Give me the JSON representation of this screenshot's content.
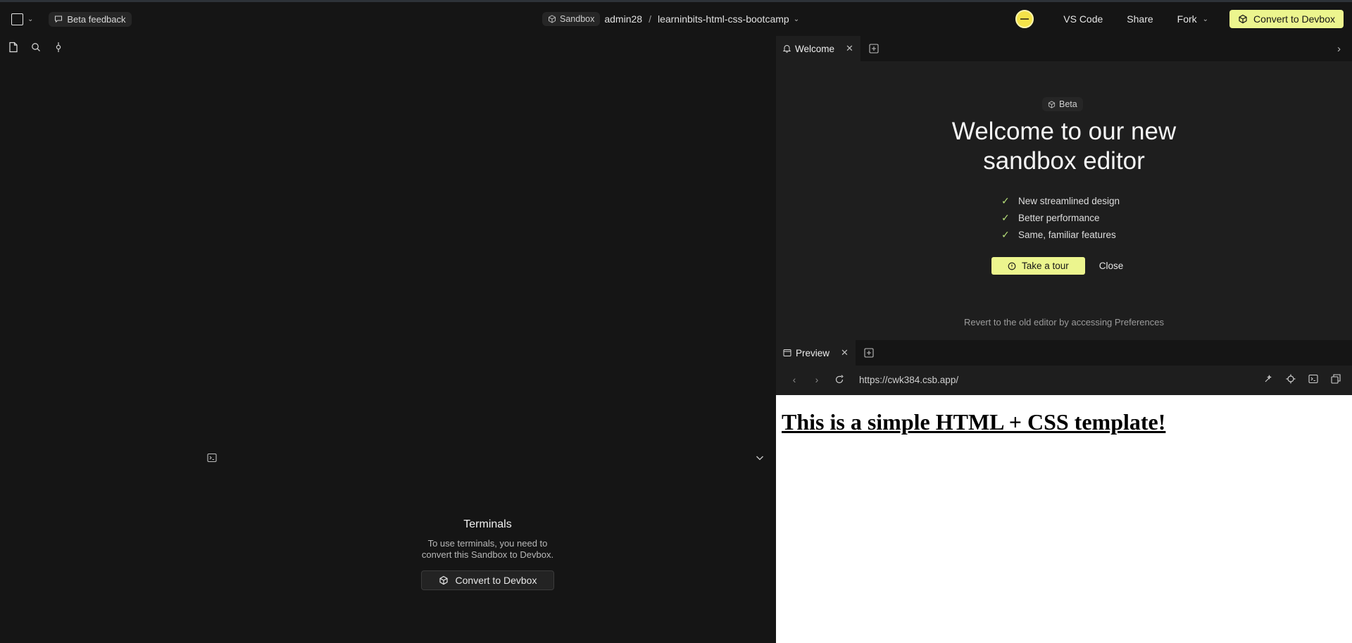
{
  "header": {
    "beta_feedback": "Beta feedback",
    "sandbox_label": "Sandbox",
    "owner": "admin28",
    "separator": "/",
    "project": "learninbits-html-css-bootcamp",
    "vscode": "VS Code",
    "share": "Share",
    "fork": "Fork",
    "convert": "Convert to Devbox",
    "accent_color": "#ecf58e"
  },
  "left_panel": {
    "icons": [
      "file-icon",
      "search-icon",
      "git-icon"
    ]
  },
  "terminal": {
    "title": "Terminals",
    "description": "To use terminals, you need to convert this Sandbox to Devbox.",
    "button": "Convert to Devbox"
  },
  "welcome_tab": {
    "label": "Welcome",
    "beta": "Beta",
    "title": "Welcome to our new sandbox editor",
    "features": [
      "New streamlined design",
      "Better performance",
      "Same, familiar features"
    ],
    "tour_button": "Take a tour",
    "close_button": "Close",
    "revert_text": "Revert to the old editor by accessing Preferences"
  },
  "preview": {
    "tab_label": "Preview",
    "url": "https://cwk384.csb.app/",
    "heading": "This is a simple HTML + CSS template!"
  }
}
